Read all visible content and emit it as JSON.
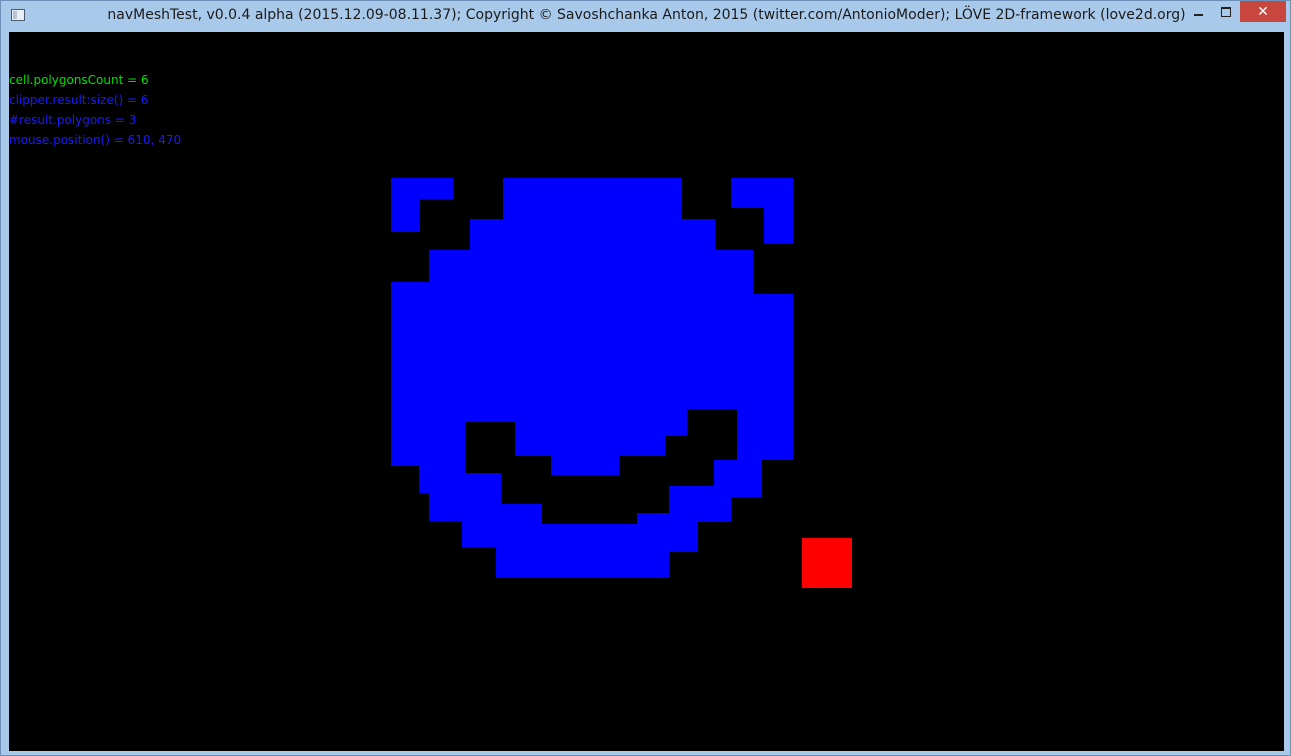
{
  "window": {
    "title": "navMeshTest, v0.0.4 alpha (2015.12.09-08.11.37); Copyright © Savoshchanka Anton, 2015 (twitter.com/AntonioModer); LÖVE 2D-framework (love2d.org)",
    "app_icon": "window-icon",
    "close_glyph": "✕"
  },
  "debug": {
    "lines": [
      {
        "text": "cell.polygonsCount = 6",
        "color": "#00e000"
      },
      {
        "text": "clipper.result:size() = 6",
        "color": "#1a1aff"
      },
      {
        "text": "#result.polygons = 3",
        "color": "#1a1aff"
      },
      {
        "text": "mouse.position() = 610, 470",
        "color": "#1a1aff"
      }
    ]
  },
  "scene": {
    "face_color": "#0000ff",
    "cursor_color": "#ff0000",
    "background": "#000000"
  }
}
